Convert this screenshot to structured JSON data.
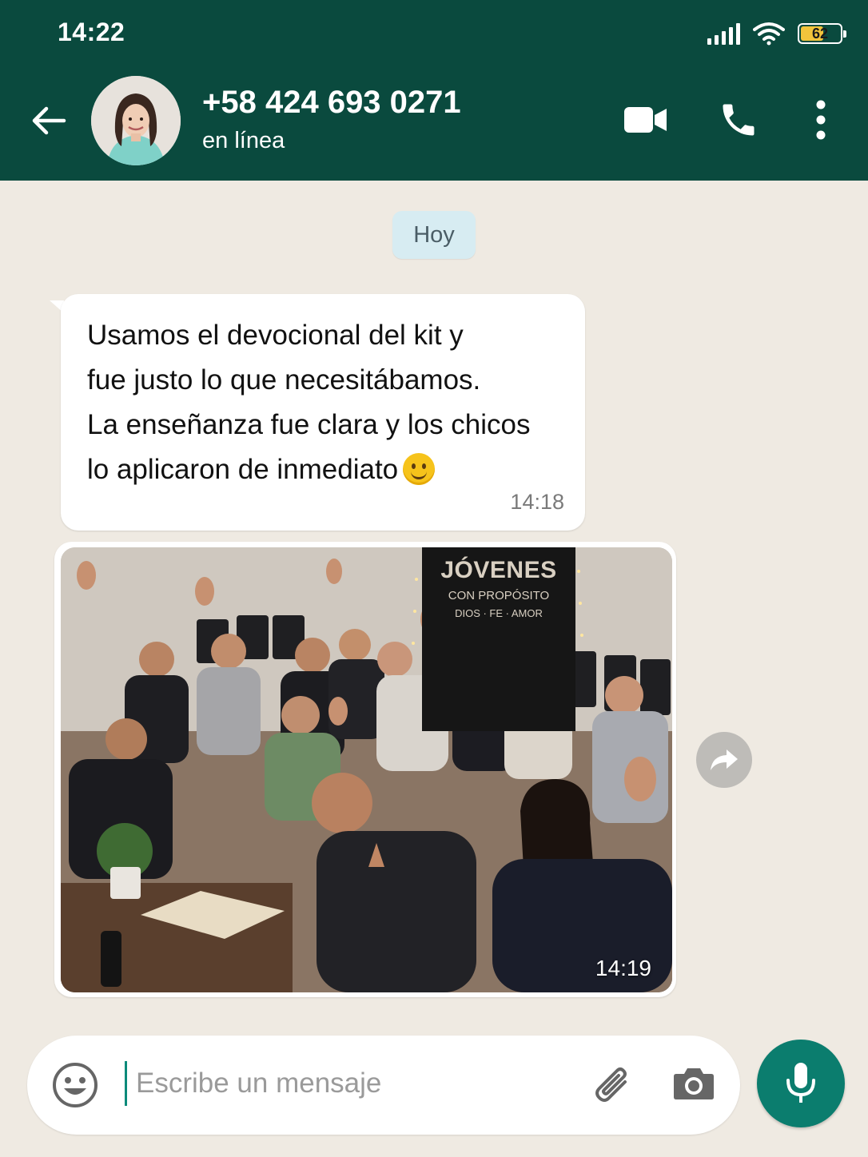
{
  "status_bar": {
    "time": "14:22",
    "battery": "62",
    "battery_level": 0.62
  },
  "header": {
    "contact_name": "+58 424 693 0271",
    "contact_status": "en línea"
  },
  "chat": {
    "date_chip": "Hoy",
    "messages": [
      {
        "type": "text",
        "lines": [
          "Usamos el devocional del kit y",
          "fue justo lo que necesitábamos.",
          "La enseñanza fue clara y los chicos",
          "lo aplicaron de inmediato"
        ],
        "emoji": "smiling-face",
        "time": "14:18"
      },
      {
        "type": "image",
        "banner": {
          "title": "JÓVENES",
          "subtitle": "CON PROPÓSITO",
          "tagline": "DIOS · FE · AMOR"
        },
        "time": "14:19"
      }
    ]
  },
  "input": {
    "placeholder": "Escribe un mensaje"
  },
  "colors": {
    "header": "#0a4a3e",
    "chat_bg": "#efeae2",
    "accent": "#0b7d6e",
    "date_chip": "#d7ecf2"
  }
}
